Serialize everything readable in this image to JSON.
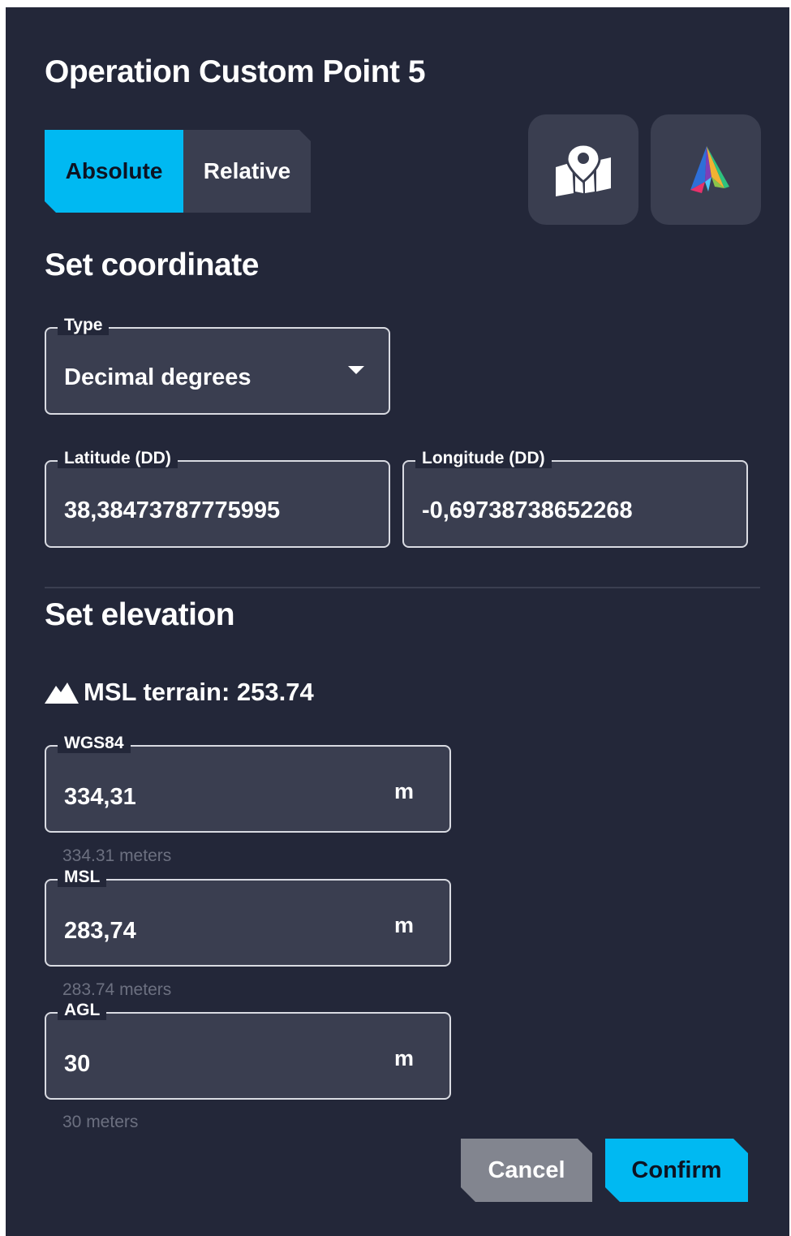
{
  "dialog": {
    "title": "Operation Custom Point 5"
  },
  "mode_toggle": {
    "absolute_label": "Absolute",
    "relative_label": "Relative",
    "selected": "Absolute"
  },
  "toolbar": {
    "map_button_icon": "map-marker-icon",
    "logo_button_icon": "app-logo-icon"
  },
  "coordinate": {
    "heading": "Set coordinate",
    "type_label": "Type",
    "type_value": "Decimal degrees",
    "latitude_label": "Latitude (DD)",
    "latitude_value": "38,38473787775995",
    "longitude_label": "Longitude (DD)",
    "longitude_value": "-0,69738738652268"
  },
  "elevation": {
    "heading": "Set elevation",
    "terrain_icon": "mountain-icon",
    "terrain_text": "MSL terrain: 253.74",
    "wgs84": {
      "label": "WGS84",
      "value": "334,31",
      "unit": "m",
      "helper": "334.31 meters"
    },
    "msl": {
      "label": "MSL",
      "value": "283,74",
      "unit": "m",
      "helper": "283.74 meters"
    },
    "agl": {
      "label": "AGL",
      "value": "30",
      "unit": "m",
      "helper": "30 meters"
    }
  },
  "actions": {
    "cancel_label": "Cancel",
    "confirm_label": "Confirm"
  },
  "colors": {
    "background": "#232739",
    "surface": "#3a3e50",
    "accent": "#00b9f2",
    "cancel": "#82858f"
  }
}
